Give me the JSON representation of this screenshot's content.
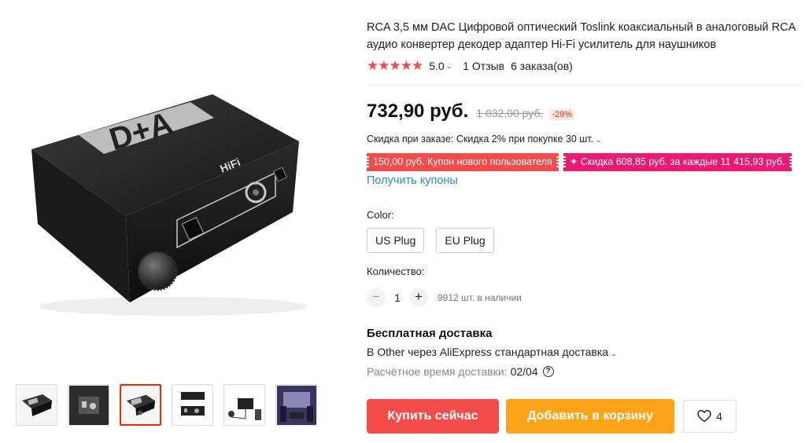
{
  "product": {
    "title": "RCA 3,5 мм DAC Цифровой оптический Toslink коаксиальный в аналоговый RCA аудио конвертер декодер адаптер Hi-Fi усилитель для наушников",
    "device_logo": "D+A",
    "device_badge": "HiFi"
  },
  "rating": {
    "stars": "★★★★★",
    "value": "5.0",
    "reviews": "1 Отзыв",
    "orders": "6 заказа(ов)"
  },
  "price": {
    "current": "732,90 руб.",
    "old": "1 032,00 руб.",
    "discount": "-29%"
  },
  "bulk_discount": "Скидка при заказе: Скидка 2% при покупке 30 шт.",
  "coupons": {
    "new_user": "150,00 руб. Купон нового пользователя",
    "store": "✦ Скидка 608,85 руб. за каждые 11 415,93 руб.",
    "get_link": "Получить купоны"
  },
  "color": {
    "label": "Color:",
    "options": [
      "US Plug",
      "EU Plug"
    ]
  },
  "quantity": {
    "label": "Количество:",
    "minus": "−",
    "plus": "+",
    "value": "1",
    "stock": "9912 шт. в наличии"
  },
  "shipping": {
    "title": "Бесплатная доставка",
    "description": "В Other через AliExpress стандартная доставка",
    "eta_label": "Расчётное время доставки:",
    "eta_value": "02/04",
    "help_glyph": "?"
  },
  "buttons": {
    "buy_now": "Купить сейчас",
    "add_to_cart": "Добавить в корзину",
    "wishlist_count": "4"
  },
  "icons": {
    "chevron": "chevron-down-icon",
    "heart": "heart-icon",
    "help": "question-circle-icon"
  },
  "colors": {
    "accent_red": "#f44b4b",
    "accent_orange": "#fca318",
    "coupon_pink": "#ea1a72",
    "link_blue": "#2c8ec6",
    "star_red": "#f44a4a"
  }
}
